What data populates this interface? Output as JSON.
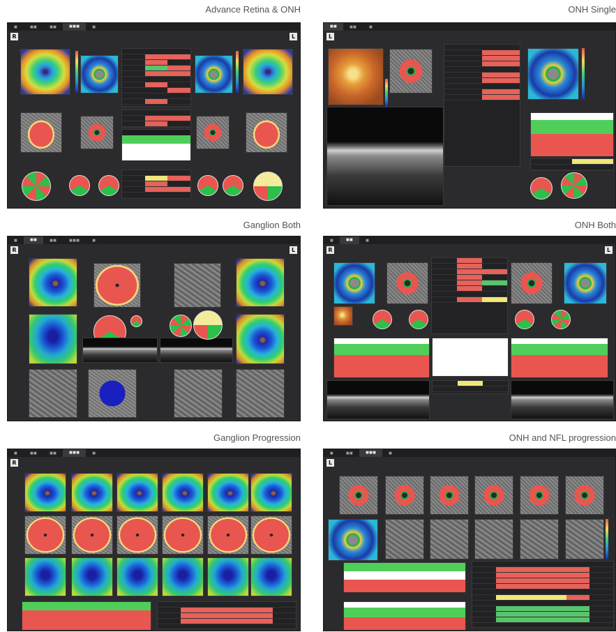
{
  "captions": {
    "advance_retina_onh": "Advance Retina & ONH",
    "onh_single": "ONH Single",
    "ganglion_both": "Ganglion Both",
    "onh_both": "ONH Both",
    "ganglion_progression": "Ganglion Progression",
    "onh_nfl_progression": "ONH and NFL progression"
  },
  "eyes": {
    "right": "R",
    "left": "L"
  },
  "colors": {
    "abnormal": "#e8564f",
    "borderline": "#f0e77a",
    "normal": "#59c46b",
    "background": "#2b2b2d"
  }
}
